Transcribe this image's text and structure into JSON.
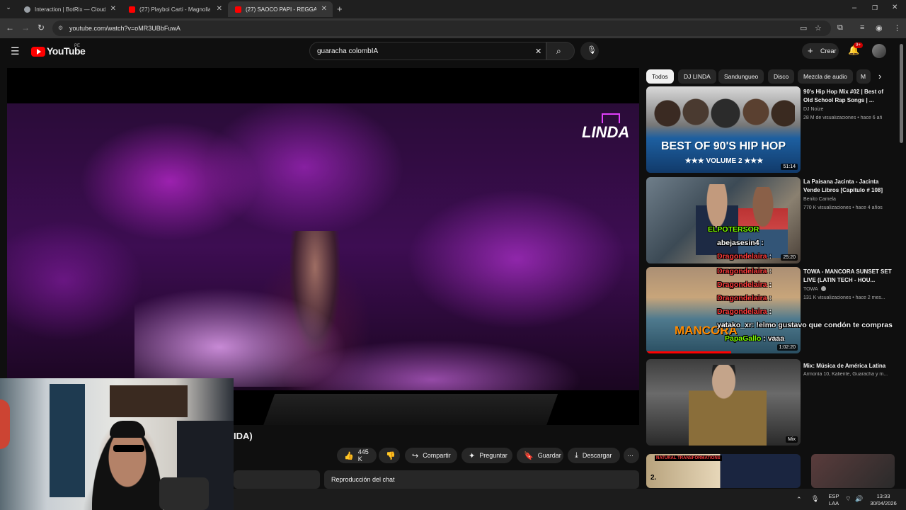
{
  "browser": {
    "tabs": [
      {
        "title": "Interaction | BotRix — Cloud St",
        "active": false,
        "favicon_color": "#9aa0a6"
      },
      {
        "title": "(27) Playboi Carti - Magnolia - ",
        "active": false,
        "favicon_color": "#ff0000"
      },
      {
        "title": "(27) SAOCO PAPI - REGGAE",
        "active": true,
        "favicon_color": "#ff0000"
      }
    ],
    "new_tab": "+",
    "url": "youtube.com/watch?v=oMR3UBbFuwA"
  },
  "youtube": {
    "logo_text": "YouTube",
    "country": "PE",
    "search_value": "guaracha colombIA",
    "create_label": "Crear",
    "notification_badge": "9+"
  },
  "video": {
    "logo_text": "LINDA",
    "title_fragment": "IDA)",
    "actions": {
      "likes": "445 K",
      "share": "Compartir",
      "ask": "Preguntar",
      "save": "Guardar",
      "download": "Descargar"
    },
    "chat_replay": "Reproducción del chat"
  },
  "sidebar": {
    "chips": [
      "Todos",
      "DJ LINDA",
      "Sandungueo",
      "Disco",
      "Mezcla de audio",
      "M"
    ],
    "videos": [
      {
        "title": "90's Hip Hop Mix #02 | Best of Old School Rap Songs | ...",
        "channel": "DJ Noize",
        "meta": "28 M de visualizaciones • hace 6 añ",
        "duration": "51:14",
        "thumb_text": "BEST OF 90'S HIP HOP",
        "thumb_sub": "★★★ VOLUME 2 ★★★"
      },
      {
        "title": "La Paisana Jacinta - Jacinta Vende Libros [Capitulo # 108]",
        "channel": "Benito Camela",
        "meta": "770 K visualizaciones • hace 4 años",
        "duration": "25:20"
      },
      {
        "title": "TOWA - MANCORA SUNSET SET LIVE (LATIN TECH - HOU...",
        "channel": "TOWA",
        "meta": "131 K visualizaciones • hace 2 mes...",
        "duration": "1:02:20",
        "thumb_text": "MANCORA"
      },
      {
        "title": "Mix: Música de América Latina",
        "channel": "Armonía 10, Kaliente, Guaracha y m...",
        "meta": "",
        "duration": "Mix"
      },
      {
        "title": "",
        "channel": "",
        "meta": "",
        "thumb_text": "NATURAL TRANSFORMATIONS",
        "thumb_sub": "2."
      }
    ]
  },
  "chat_overlay": [
    {
      "user": "ELPOTERSOR",
      "msg": "",
      "color": "#7cfc00"
    },
    {
      "user": "abejasesin4",
      "msg": ":",
      "color": "#ffffff"
    },
    {
      "user": "Dragondelaira",
      "msg": ":",
      "color": "#ff3b3b"
    },
    {
      "user": "Dragondelaira",
      "msg": ":",
      "color": "#ff3b3b"
    },
    {
      "user": "Dragondelaira",
      "msg": ":",
      "color": "#ff3b3b"
    },
    {
      "user": "Dragondelaira",
      "msg": ":",
      "color": "#ff3b3b"
    },
    {
      "user": "Dragondelaira",
      "msg": ":",
      "color": "#ff3b3b"
    },
    {
      "user": "yatako_xr",
      "msg": ": !elmo gustavo que condón te compras",
      "color": "#ffffff"
    },
    {
      "user": "PapaGallo",
      "msg": ": vaaa",
      "color": "#7cfc00"
    }
  ],
  "taskbar": {
    "lang": "ESP",
    "lang2": "LAA",
    "time": "13:33",
    "date": "30/04/2026"
  },
  "colors": {
    "accent": "#ff0000",
    "bg": "#0f0f0f"
  }
}
